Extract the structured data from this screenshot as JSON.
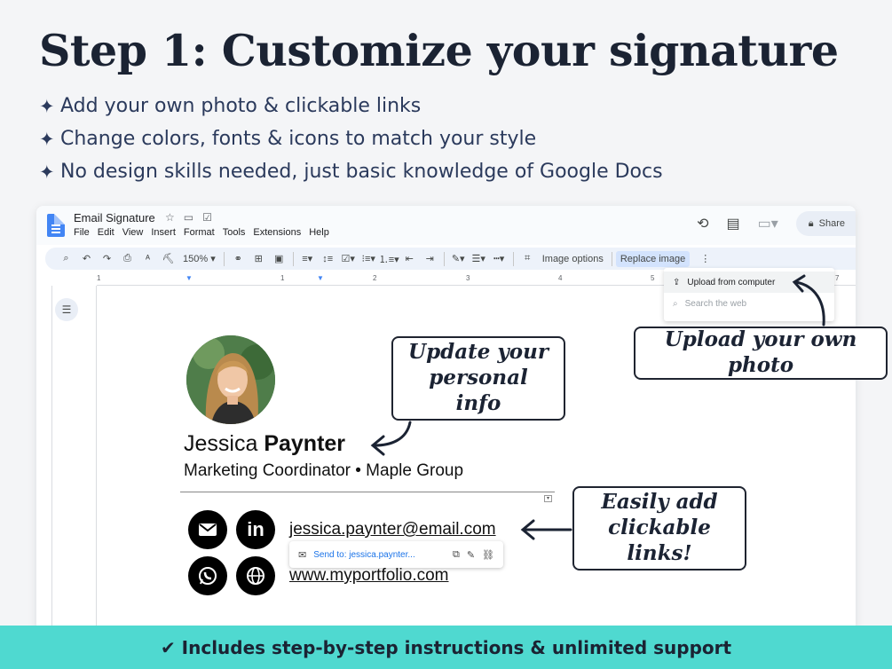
{
  "headline": "Step 1: Customize your signature",
  "bullets": [
    "Add your own photo & clickable links",
    "Change colors, fonts & icons to match your style",
    "No design skills needed, just basic knowledge of Google Docs"
  ],
  "docs": {
    "title": "Email Signature",
    "menus": [
      "File",
      "Edit",
      "View",
      "Insert",
      "Format",
      "Tools",
      "Extensions",
      "Help"
    ],
    "share_label": "Share",
    "zoom": "150%",
    "image_options": "Image options",
    "replace_image": "Replace image",
    "ruler_numbers": [
      "1",
      "1",
      "2",
      "3",
      "4",
      "5",
      "7"
    ],
    "dropdown": {
      "upload": "Upload from computer",
      "search": "Search the web"
    }
  },
  "signature": {
    "first_name": "Jessica",
    "last_name": "Paynter",
    "role": "Marketing Coordinator • Maple Group",
    "email": "jessica.paynter@email.com",
    "website": "www.myportfolio.com",
    "link_popup": "Send to: jessica.paynter..."
  },
  "callouts": {
    "update": "Update your personal info",
    "upload": "Upload your own photo",
    "links": "Easily add clickable links!"
  },
  "footer": "✔ Includes step-by-step instructions & unlimited support",
  "colors": {
    "background": "#f4f5f7",
    "footer": "#4fd9d0",
    "accent_blue": "#4285f4",
    "link_blue": "#1a73e8"
  }
}
